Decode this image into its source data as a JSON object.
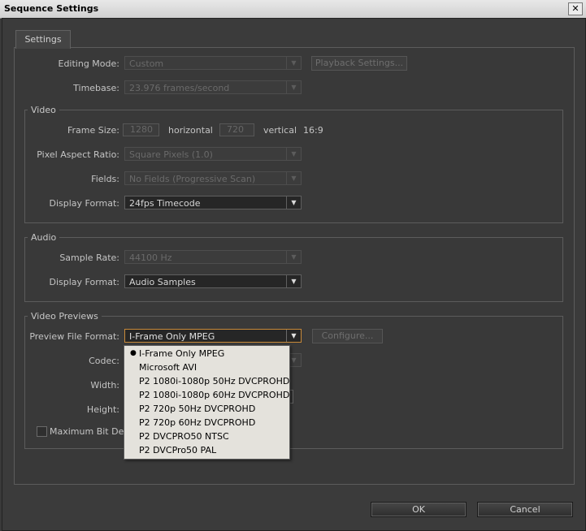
{
  "window": {
    "title": "Sequence Settings",
    "close_glyph": "✕"
  },
  "tab": {
    "label": "Settings"
  },
  "top": {
    "editing_mode_label": "Editing Mode:",
    "editing_mode_value": "Custom",
    "playback_settings_label": "Playback Settings...",
    "timebase_label": "Timebase:",
    "timebase_value": "23.976 frames/second"
  },
  "video": {
    "title": "Video",
    "frame_size_label": "Frame Size:",
    "width": "1280",
    "horizontal_label": "horizontal",
    "height": "720",
    "vertical_label": "vertical",
    "aspect": "16:9",
    "pixel_aspect_label": "Pixel Aspect Ratio:",
    "pixel_aspect_value": "Square Pixels (1.0)",
    "fields_label": "Fields:",
    "fields_value": "No Fields (Progressive Scan)",
    "display_format_label": "Display Format:",
    "display_format_value": "24fps Timecode"
  },
  "audio": {
    "title": "Audio",
    "sample_rate_label": "Sample Rate:",
    "sample_rate_value": "44100 Hz",
    "display_format_label": "Display Format:",
    "display_format_value": "Audio Samples"
  },
  "previews": {
    "title": "Video Previews",
    "file_format_label": "Preview File Format:",
    "file_format_value": "I-Frame Only MPEG",
    "configure_label": "Configure...",
    "codec_label": "Codec:",
    "width_label": "Width:",
    "height_label": "Height:",
    "max_bit_depth_label": "Maximum Bit Dept"
  },
  "dropdown": {
    "selected_index": 0,
    "bullet": "●",
    "options": [
      "I-Frame Only MPEG",
      "Microsoft AVI",
      "P2 1080i-1080p 50Hz DVCPROHD",
      "P2 1080i-1080p 60Hz DVCPROHD",
      "P2 720p 50Hz DVCPROHD",
      "P2 720p 60Hz DVCPROHD",
      "P2 DVCPRO50 NTSC",
      "P2 DVCPro50 PAL"
    ]
  },
  "footer": {
    "ok_label": "OK",
    "cancel_label": "Cancel"
  },
  "colors": {
    "focus_border": "#c88a3a",
    "window_bg": "#3b3b3b",
    "dropdown_bg": "#e4e2dc"
  },
  "icons": {
    "dropdown_arrow": "▼"
  }
}
